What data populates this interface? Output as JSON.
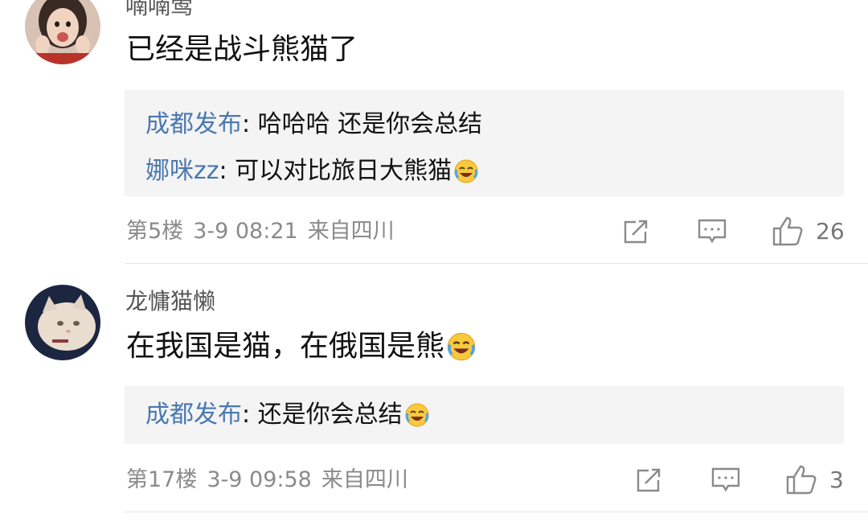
{
  "comments": [
    {
      "username": "喃喃莺",
      "content": "已经是战斗熊猫了",
      "content_emoji": null,
      "replies": [
        {
          "author": "成都发布",
          "sep": ":",
          "text": " 哈哈哈 还是你会总结",
          "emoji": null
        },
        {
          "author": "娜咪zz",
          "sep": ":",
          "text": " 可以对比旅日大熊猫",
          "emoji": "laughing-crying-emoji"
        }
      ],
      "floor": "第5楼",
      "date": "3-9 08:21",
      "location": "来自四川",
      "likes": "26"
    },
    {
      "username": "龙慵猫懒",
      "content": "在我国是猫，在俄国是熊",
      "content_emoji": "laughing-crying-emoji",
      "replies": [
        {
          "author": "成都发布",
          "sep": ":",
          "text": " 还是你会总结",
          "emoji": "laughing-crying-emoji"
        }
      ],
      "floor": "第17楼",
      "date": "3-9 09:58",
      "location": "来自四川",
      "likes": "3"
    }
  ],
  "icons": {
    "repost": "share-icon",
    "comment": "comment-icon",
    "like": "thumbs-up-icon"
  },
  "colors": {
    "reply_author": "#4a78b0",
    "reply_bg": "#f4f4f4",
    "meta_text": "#8a8a8a"
  }
}
